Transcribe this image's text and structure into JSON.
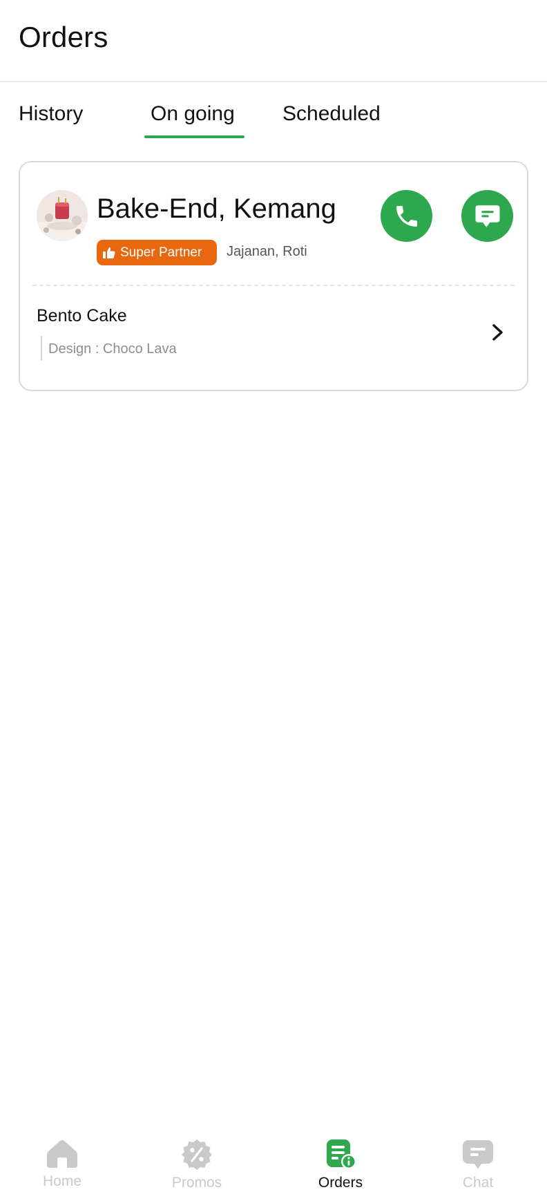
{
  "header": {
    "title": "Orders"
  },
  "tabs": [
    {
      "label": "History",
      "active": false
    },
    {
      "label": "On going",
      "active": true
    },
    {
      "label": "Scheduled",
      "active": false
    }
  ],
  "order": {
    "store_name": "Bake-End, Kemang",
    "badge": "Super Partner",
    "categories": "Jajanan, Roti",
    "item_name": "Bento Cake",
    "item_note": "Design : Choco Lava",
    "avatar_icon": "cake-photo-avatar",
    "call_icon": "phone-icon",
    "chat_icon": "message-icon"
  },
  "bottom_nav": [
    {
      "label": "Home",
      "icon": "home-icon",
      "active": false
    },
    {
      "label": "Promos",
      "icon": "percent-badge-icon",
      "active": false
    },
    {
      "label": "Orders",
      "icon": "orders-icon",
      "active": true
    },
    {
      "label": "Chat",
      "icon": "chat-icon",
      "active": false
    }
  ],
  "colors": {
    "accent_green": "#2ea84e",
    "badge_orange": "#e8670f",
    "inactive_nav": "#c9c9c9",
    "card_border": "#d9d9d9"
  }
}
